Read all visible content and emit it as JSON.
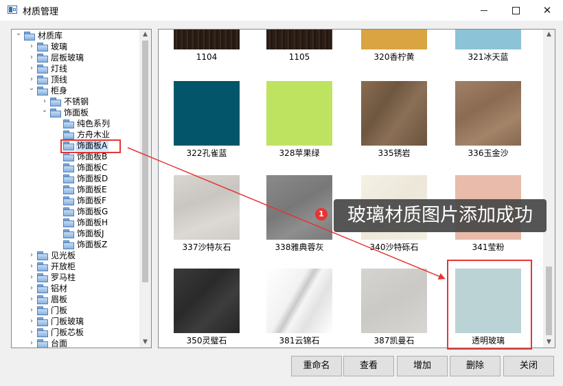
{
  "window": {
    "title": "材质管理"
  },
  "tree": {
    "nodes": [
      {
        "label": "材质库",
        "indent": 0,
        "expanded": true
      },
      {
        "label": "玻璃",
        "indent": 1
      },
      {
        "label": "层板玻璃",
        "indent": 1
      },
      {
        "label": "灯线",
        "indent": 1
      },
      {
        "label": "顶线",
        "indent": 1
      },
      {
        "label": "柜身",
        "indent": 1,
        "expanded": true
      },
      {
        "label": "不锈钢",
        "indent": 2
      },
      {
        "label": "饰面板",
        "indent": 2,
        "expanded": true
      },
      {
        "label": "纯色系列",
        "indent": 3
      },
      {
        "label": "方舟木业",
        "indent": 3
      },
      {
        "label": "饰面板A",
        "indent": 3,
        "selected": true
      },
      {
        "label": "饰面板B",
        "indent": 3
      },
      {
        "label": "饰面板C",
        "indent": 3
      },
      {
        "label": "饰面板D",
        "indent": 3
      },
      {
        "label": "饰面板E",
        "indent": 3
      },
      {
        "label": "饰面板F",
        "indent": 3
      },
      {
        "label": "饰面板G",
        "indent": 3
      },
      {
        "label": "饰面板H",
        "indent": 3
      },
      {
        "label": "饰面板J",
        "indent": 3
      },
      {
        "label": "饰面板Z",
        "indent": 3
      },
      {
        "label": "见光板",
        "indent": 1
      },
      {
        "label": "开放柜",
        "indent": 1
      },
      {
        "label": "罗马柱",
        "indent": 1
      },
      {
        "label": "铝材",
        "indent": 1
      },
      {
        "label": "眉板",
        "indent": 1
      },
      {
        "label": "门板",
        "indent": 1
      },
      {
        "label": "门板玻璃",
        "indent": 1
      },
      {
        "label": "门板芯板",
        "indent": 1
      },
      {
        "label": "台面",
        "indent": 1
      }
    ]
  },
  "materials": [
    {
      "label": "1104",
      "color": "#2f2119",
      "texture": "1104"
    },
    {
      "label": "1105",
      "color": "#2f2119",
      "texture": "1105"
    },
    {
      "label": "320香柠黄",
      "color": "#d9a441"
    },
    {
      "label": "321冰天蓝",
      "color": "#8cc3d7"
    },
    {
      "label": "322孔雀蓝",
      "color": "#03566a"
    },
    {
      "label": "328苹果绿",
      "color": "#bde361"
    },
    {
      "label": "335锈岩",
      "color": "#7b6047",
      "texture": "335"
    },
    {
      "label": "336玉金沙",
      "color": "#957459",
      "texture": "336"
    },
    {
      "label": "337沙特灰石",
      "color": "#d4d0cb",
      "texture": "337"
    },
    {
      "label": "338雅典蓉灰",
      "color": "#838383",
      "texture": "338"
    },
    {
      "label": "340沙特砾石",
      "color": "#f1ede2",
      "texture": "340"
    },
    {
      "label": "341莹粉",
      "color": "#e8bbaa"
    },
    {
      "label": "350灵璧石",
      "color": "#333333",
      "texture": "350"
    },
    {
      "label": "381云锦石",
      "color": "#eeeeee",
      "texture": "381"
    },
    {
      "label": "387凯曼石",
      "color": "#d1cfcc",
      "texture": "387"
    },
    {
      "label": "透明玻璃",
      "color": "#bcd3d6"
    }
  ],
  "notification": {
    "badge": "1",
    "message": "玻璃材质图片添加成功"
  },
  "buttons": {
    "rename": "重命名",
    "view": "查看",
    "add": "增加",
    "delete": "删除",
    "close": "关闭"
  },
  "colors": {
    "annotation_red": "#e63434",
    "selection": "#cde8ff"
  }
}
